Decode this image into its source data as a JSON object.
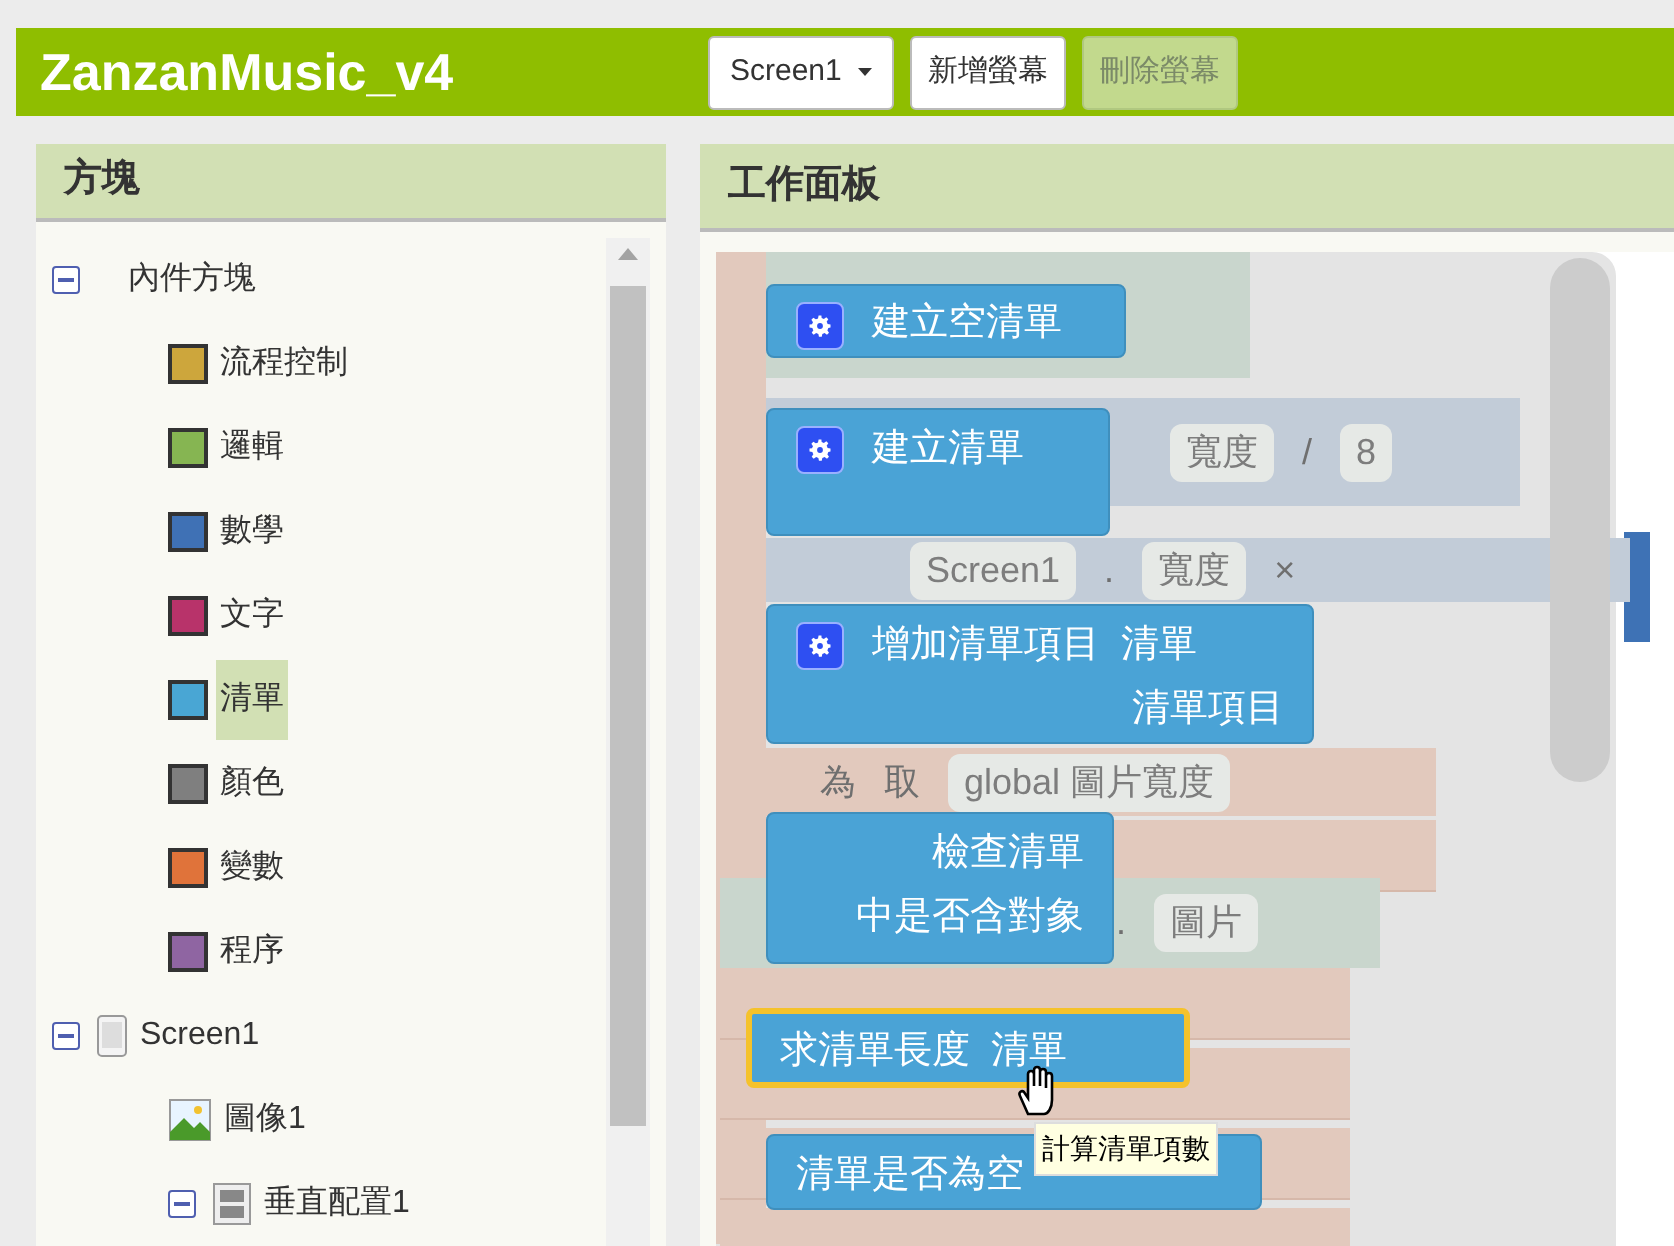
{
  "project_title": "ZanzanMusic_v4",
  "toolbar": {
    "screen_select": "Screen1",
    "buttons": [
      {
        "label": "新增螢幕",
        "disabled": false
      },
      {
        "label": "刪除螢幕",
        "disabled": true
      }
    ]
  },
  "blocks_panel": {
    "title": "方塊",
    "tree": [
      {
        "label": "內件方塊",
        "kind": "group",
        "expanded": true,
        "selected": false,
        "children": [
          {
            "label": "流程控制",
            "kind": "drawer",
            "color": "#cda63c",
            "selected": false
          },
          {
            "label": "邏輯",
            "kind": "drawer",
            "color": "#86b552",
            "selected": false
          },
          {
            "label": "數學",
            "kind": "drawer",
            "color": "#3f71b5",
            "selected": false
          },
          {
            "label": "文字",
            "kind": "drawer",
            "color": "#b8336a",
            "selected": false
          },
          {
            "label": "清單",
            "kind": "drawer",
            "color": "#49a6d4",
            "selected": true
          },
          {
            "label": "顏色",
            "kind": "drawer",
            "color": "#7f7f7f",
            "selected": false
          },
          {
            "label": "變數",
            "kind": "drawer",
            "color": "#e0733a",
            "selected": false
          },
          {
            "label": "程序",
            "kind": "drawer",
            "color": "#8f65a2",
            "selected": false
          }
        ]
      },
      {
        "label": "Screen1",
        "kind": "screen",
        "expanded": true,
        "selected": false,
        "children": [
          {
            "label": "圖像1",
            "kind": "image",
            "selected": false
          },
          {
            "label": "垂直配置1",
            "kind": "arrangement",
            "expanded": true,
            "selected": false
          }
        ]
      }
    ]
  },
  "viewer": {
    "title": "工作面板",
    "background_blocks": [
      {
        "kind": "math",
        "parts": [
          {
            "kind": "pill",
            "text": "寬度"
          },
          {
            "kind": "text",
            "text": "/"
          },
          {
            "kind": "pill",
            "text": "8"
          }
        ]
      },
      {
        "kind": "math",
        "parts": [
          {
            "kind": "pill",
            "text": "Screen1"
          },
          {
            "kind": "text",
            "text": "."
          },
          {
            "kind": "pill",
            "text": "寬度"
          },
          {
            "kind": "text",
            "text": "×"
          }
        ]
      },
      {
        "kind": "variable",
        "parts": [
          {
            "kind": "text",
            "text": "為"
          },
          {
            "kind": "text",
            "text": "取"
          },
          {
            "kind": "pill",
            "text": "global 圖片寬度"
          }
        ]
      },
      {
        "kind": "component",
        "parts": [
          {
            "kind": "text",
            "text": "."
          },
          {
            "kind": "pill",
            "text": "圖片"
          }
        ]
      }
    ],
    "blocks": [
      {
        "lines": [
          "建立空清單"
        ],
        "mutator": true,
        "selected": false
      },
      {
        "lines": [
          "建立清單"
        ],
        "mutator": true,
        "selected": false
      },
      {
        "lines": [
          "增加清單項目  清單",
          "清單項目"
        ],
        "mutator": true,
        "selected": false
      },
      {
        "lines": [
          "檢查清單",
          "中是否含對象"
        ],
        "mutator": false,
        "selected": false
      },
      {
        "lines": [
          "求清單長度  清單"
        ],
        "mutator": false,
        "selected": true
      },
      {
        "lines": [
          "清單是否為空"
        ],
        "mutator": false,
        "selected": false
      }
    ],
    "tooltip": "計算清單項數"
  }
}
